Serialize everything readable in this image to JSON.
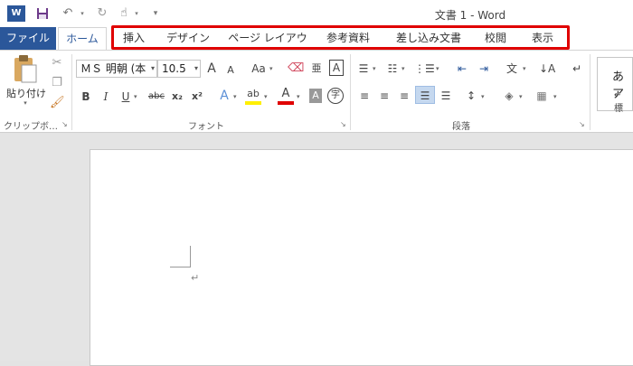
{
  "window": {
    "title": "文書 1 - Word"
  },
  "quick_access": {
    "app_icon_letter": "W",
    "save_icon": "save-icon",
    "undo_icon": "undo-icon",
    "redo_icon": "redo-icon",
    "touch_icon": "touch-mode-icon",
    "customize_icon": "customize-qat-icon"
  },
  "tabs": {
    "file": "ファイル",
    "home": "ホーム",
    "others": [
      "挿入",
      "デザイン",
      "ページ レイアウト",
      "参考資料",
      "差し込み文書",
      "校閲",
      "表示"
    ]
  },
  "ribbon": {
    "clipboard": {
      "paste_label": "貼り付け",
      "group_label": "クリップボ…"
    },
    "font": {
      "font_name": "ＭＳ 明朝 (本",
      "font_size": "10.5",
      "group_label": "フォント",
      "bold": "B",
      "italic": "I",
      "underline": "U",
      "strike": "abc",
      "subscript": "x₂",
      "superscript": "x²",
      "grow": "A",
      "shrink": "A",
      "case": "Aa",
      "ruby": "亜",
      "border_char": "A",
      "enclose": "字",
      "shade": "A",
      "text_effect": "A",
      "highlight": "ab",
      "font_color": "A"
    },
    "paragraph": {
      "group_label": "段落"
    },
    "styles": {
      "preview_text": "あア",
      "preview_label": "↵ 標"
    }
  },
  "document": {
    "paragraph_mark": "↵"
  },
  "colors": {
    "accent": "#2b579a",
    "highlight_box": "#e00000",
    "word_blue": "#2b579a"
  }
}
